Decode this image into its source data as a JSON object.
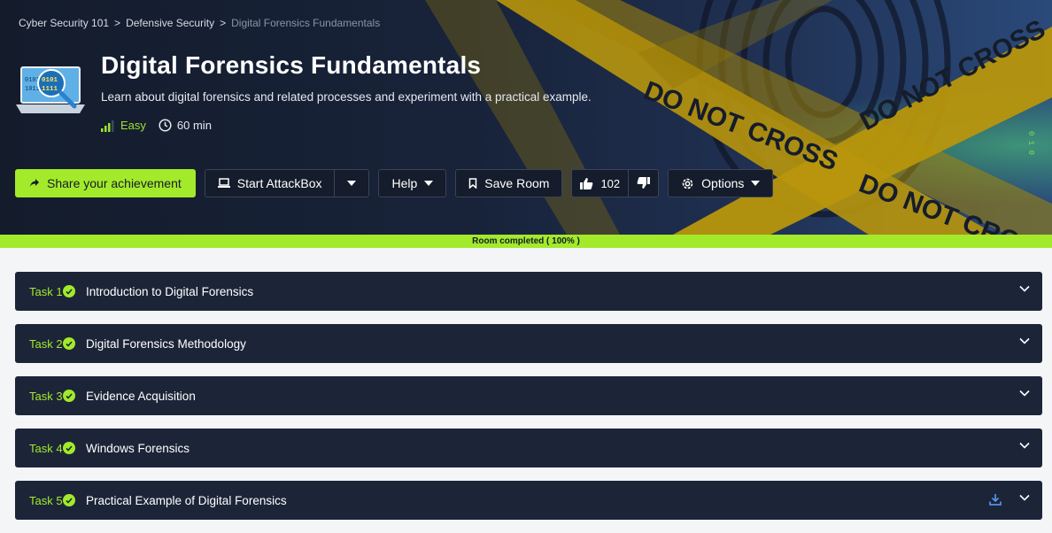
{
  "breadcrumb": {
    "items": [
      "Cyber Security 101",
      "Defensive Security",
      "Digital Forensics Fundamentals"
    ],
    "separator": ">"
  },
  "room": {
    "title": "Digital Forensics Fundamentals",
    "description": "Learn about digital forensics and related processes and experiment with a practical example.",
    "difficulty": "Easy",
    "duration": "60 min",
    "icon": "laptop-binary-magnifier-icon"
  },
  "hero_art": {
    "tape_text": "DO NOT CROSS",
    "tape_color": "#b8960c",
    "binary": "0 1 0"
  },
  "actions": {
    "share_label": "Share your achievement",
    "attackbox_label": "Start AttackBox",
    "help_label": "Help",
    "save_label": "Save Room",
    "likes": "102",
    "options_label": "Options"
  },
  "progress": {
    "label": "Room completed ( 100% )",
    "value": 100
  },
  "tasks": [
    {
      "number": "Task 1",
      "title": "Introduction to Digital Forensics",
      "completed": true
    },
    {
      "number": "Task 2",
      "title": "Digital Forensics Methodology",
      "completed": true
    },
    {
      "number": "Task 3",
      "title": "Evidence Acquisition",
      "completed": true
    },
    {
      "number": "Task 4",
      "title": "Windows Forensics",
      "completed": true
    },
    {
      "number": "Task 5",
      "title": "Practical Example of Digital Forensics",
      "completed": true,
      "has_download": true
    }
  ],
  "colors": {
    "accent": "#a3ea2a",
    "panel": "#1c2538",
    "hero_bg": "#151c2b"
  }
}
